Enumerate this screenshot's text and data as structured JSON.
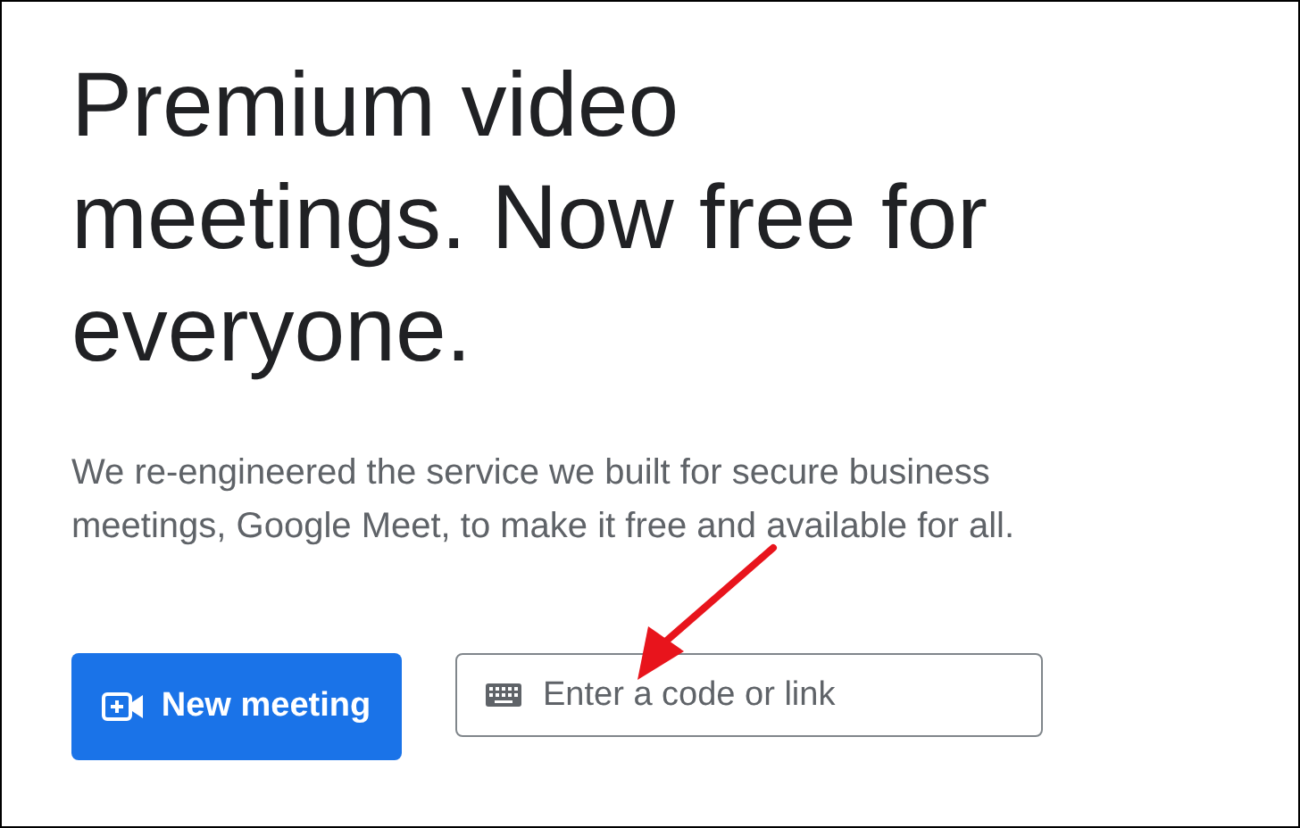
{
  "heading_lines": [
    "Premium video",
    "meetings. Now free for",
    "everyone."
  ],
  "description": "We re-engineered the service we built for secure business meetings, Google Meet, to make it free and available for all.",
  "new_meeting_button": {
    "label": "New meeting"
  },
  "code_field": {
    "placeholder": "Enter a code or link"
  }
}
